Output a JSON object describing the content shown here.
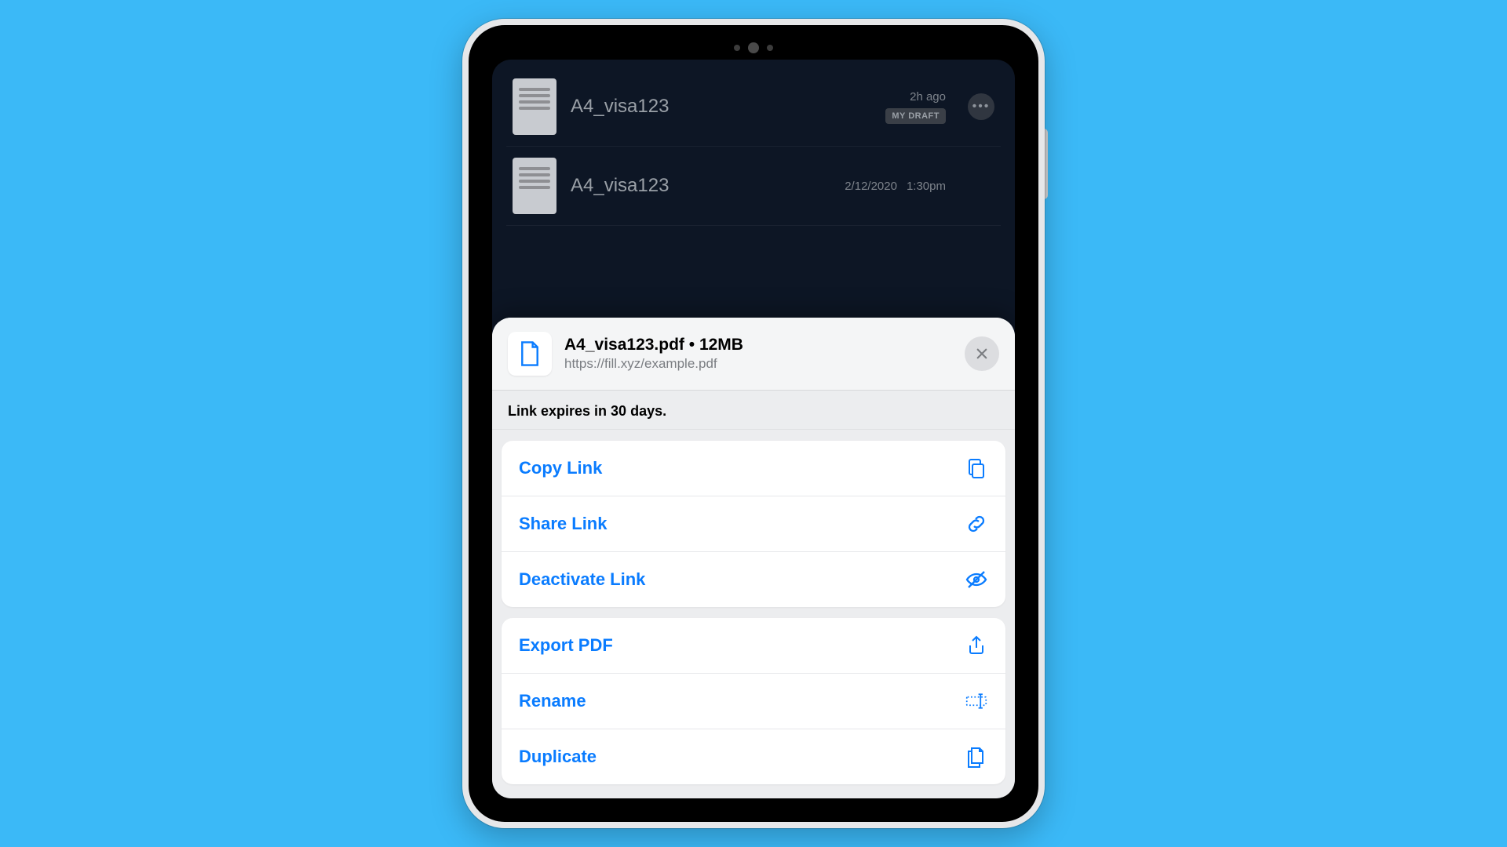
{
  "background_rows": [
    {
      "title": "A4_visa123",
      "time": "2h ago",
      "draft": "MY DRAFT"
    },
    {
      "title": "A4_visa123",
      "date": "2/12/2020",
      "time": "1:30pm"
    }
  ],
  "sheet": {
    "file_title": "A4_visa123.pdf • 12MB",
    "file_url": "https://fill.xyz/example.pdf",
    "subtext": "Link expires in 30 days.",
    "groups": [
      {
        "items": [
          {
            "key": "copy",
            "label": "Copy Link"
          },
          {
            "key": "share",
            "label": "Share Link"
          },
          {
            "key": "deactivate",
            "label": "Deactivate Link"
          }
        ]
      },
      {
        "items": [
          {
            "key": "export",
            "label": "Export PDF"
          },
          {
            "key": "rename",
            "label": "Rename"
          },
          {
            "key": "duplicate",
            "label": "Duplicate"
          }
        ]
      }
    ]
  }
}
